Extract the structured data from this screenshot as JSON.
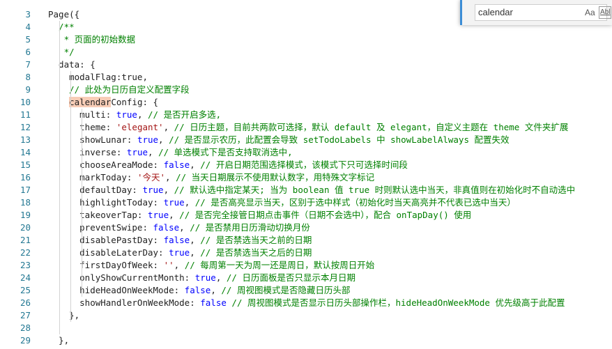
{
  "editor": {
    "lines": [
      {
        "n": "3",
        "segs": [
          {
            "t": "Page({",
            "c": ""
          }
        ]
      },
      {
        "n": "4",
        "segs": [
          {
            "t": "  /**",
            "c": "com"
          }
        ]
      },
      {
        "n": "5",
        "segs": [
          {
            "t": "   * 页面的初始数据",
            "c": "com"
          }
        ]
      },
      {
        "n": "6",
        "segs": [
          {
            "t": "   */",
            "c": "com"
          }
        ]
      },
      {
        "n": "7",
        "segs": [
          {
            "t": "  data: {",
            "c": ""
          }
        ]
      },
      {
        "n": "8",
        "segs": [
          {
            "t": "    modalFlag:",
            "c": ""
          },
          {
            "t": "true",
            "c": ""
          },
          {
            "t": ",",
            "c": ""
          }
        ]
      },
      {
        "n": "9",
        "segs": [
          {
            "t": "    // 此处为日历自定义配置字段",
            "c": "com"
          }
        ]
      },
      {
        "n": "10",
        "segs": [
          {
            "t": "    ",
            "c": ""
          },
          {
            "t": "calendar",
            "c": "hl"
          },
          {
            "t": "Config: {",
            "c": ""
          }
        ]
      },
      {
        "n": "11",
        "segs": [
          {
            "t": "      multi: ",
            "c": ""
          },
          {
            "t": "true",
            "c": "kw"
          },
          {
            "t": ", ",
            "c": ""
          },
          {
            "t": "// 是否开启多选,",
            "c": "com"
          }
        ]
      },
      {
        "n": "12",
        "segs": [
          {
            "t": "      theme: ",
            "c": ""
          },
          {
            "t": "'elegant'",
            "c": "str"
          },
          {
            "t": ", ",
            "c": ""
          },
          {
            "t": "// 日历主题，目前共两款可选择，默认 default 及 elegant，自定义主题在 theme 文件夹扩展",
            "c": "com"
          }
        ]
      },
      {
        "n": "13",
        "segs": [
          {
            "t": "      showLunar: ",
            "c": ""
          },
          {
            "t": "true",
            "c": "kw"
          },
          {
            "t": ", ",
            "c": ""
          },
          {
            "t": "// 是否显示农历，此配置会导致 setTodoLabels 中 showLabelAlways 配置失效",
            "c": "com"
          }
        ]
      },
      {
        "n": "14",
        "segs": [
          {
            "t": "      inverse: ",
            "c": ""
          },
          {
            "t": "true",
            "c": "kw"
          },
          {
            "t": ", ",
            "c": ""
          },
          {
            "t": "// 单选模式下是否支持取消选中,",
            "c": "com"
          }
        ]
      },
      {
        "n": "15",
        "segs": [
          {
            "t": "      chooseAreaMode: ",
            "c": ""
          },
          {
            "t": "false",
            "c": "kw"
          },
          {
            "t": ", ",
            "c": ""
          },
          {
            "t": "// 开启日期范围选择模式，该模式下只可选择时间段",
            "c": "com"
          }
        ]
      },
      {
        "n": "16",
        "segs": [
          {
            "t": "      markToday: ",
            "c": ""
          },
          {
            "t": "'今天'",
            "c": "str"
          },
          {
            "t": ", ",
            "c": ""
          },
          {
            "t": "// 当天日期展示不使用默认数字，用特殊文字标记",
            "c": "com"
          }
        ]
      },
      {
        "n": "17",
        "segs": [
          {
            "t": "      defaultDay: ",
            "c": ""
          },
          {
            "t": "true",
            "c": "kw"
          },
          {
            "t": ", ",
            "c": ""
          },
          {
            "t": "// 默认选中指定某天; 当为 boolean 值 true 时则默认选中当天，非真值则在初始化时不自动选中",
            "c": "com"
          }
        ]
      },
      {
        "n": "18",
        "segs": [
          {
            "t": "      highlightToday: ",
            "c": ""
          },
          {
            "t": "true",
            "c": "kw"
          },
          {
            "t": ", ",
            "c": ""
          },
          {
            "t": "// 是否高亮显示当天，区别于选中样式（初始化时当天高亮并不代表已选中当天）",
            "c": "com"
          }
        ]
      },
      {
        "n": "19",
        "segs": [
          {
            "t": "      takeoverTap: ",
            "c": ""
          },
          {
            "t": "true",
            "c": "kw"
          },
          {
            "t": ", ",
            "c": ""
          },
          {
            "t": "// 是否完全接管日期点击事件（日期不会选中），配合 onTapDay() 使用",
            "c": "com"
          }
        ]
      },
      {
        "n": "20",
        "segs": [
          {
            "t": "      preventSwipe: ",
            "c": ""
          },
          {
            "t": "false",
            "c": "kw"
          },
          {
            "t": ", ",
            "c": ""
          },
          {
            "t": "// 是否禁用日历滑动切换月份",
            "c": "com"
          }
        ]
      },
      {
        "n": "21",
        "segs": [
          {
            "t": "      disablePastDay: ",
            "c": ""
          },
          {
            "t": "false",
            "c": "kw"
          },
          {
            "t": ", ",
            "c": ""
          },
          {
            "t": "// 是否禁选当天之前的日期",
            "c": "com"
          }
        ]
      },
      {
        "n": "22",
        "segs": [
          {
            "t": "      disableLaterDay: ",
            "c": ""
          },
          {
            "t": "true",
            "c": "kw"
          },
          {
            "t": ", ",
            "c": ""
          },
          {
            "t": "// 是否禁选当天之后的日期",
            "c": "com"
          }
        ]
      },
      {
        "n": "23",
        "segs": [
          {
            "t": "      firstDayOfWeek: ",
            "c": ""
          },
          {
            "t": "''",
            "c": "str"
          },
          {
            "t": ", ",
            "c": ""
          },
          {
            "t": "// 每周第一天为周一还是周日，默认按周日开始",
            "c": "com"
          }
        ]
      },
      {
        "n": "24",
        "segs": [
          {
            "t": "      onlyShowCurrentMonth: ",
            "c": ""
          },
          {
            "t": "true",
            "c": "kw"
          },
          {
            "t": ", ",
            "c": ""
          },
          {
            "t": "// 日历面板是否只显示本月日期",
            "c": "com"
          }
        ]
      },
      {
        "n": "25",
        "segs": [
          {
            "t": "      hideHeadOnWeekMode: ",
            "c": ""
          },
          {
            "t": "false",
            "c": "kw"
          },
          {
            "t": ", ",
            "c": ""
          },
          {
            "t": "// 周视图模式是否隐藏日历头部",
            "c": "com"
          }
        ]
      },
      {
        "n": "26",
        "segs": [
          {
            "t": "      showHandlerOnWeekMode: ",
            "c": ""
          },
          {
            "t": "false",
            "c": "kw"
          },
          {
            "t": " ",
            "c": ""
          },
          {
            "t": "// 周视图模式是否显示日历头部操作栏，hideHeadOnWeekMode 优先级高于此配置",
            "c": "com"
          }
        ]
      },
      {
        "n": "27",
        "segs": [
          {
            "t": "    },",
            "c": ""
          }
        ]
      },
      {
        "n": "28",
        "segs": [
          {
            "t": "",
            "c": ""
          }
        ]
      },
      {
        "n": "29",
        "segs": [
          {
            "t": "  },",
            "c": ""
          }
        ]
      }
    ]
  },
  "find_widget": {
    "query": "calendar",
    "match_case_label": "Aa",
    "whole_word_label": "Abl"
  }
}
